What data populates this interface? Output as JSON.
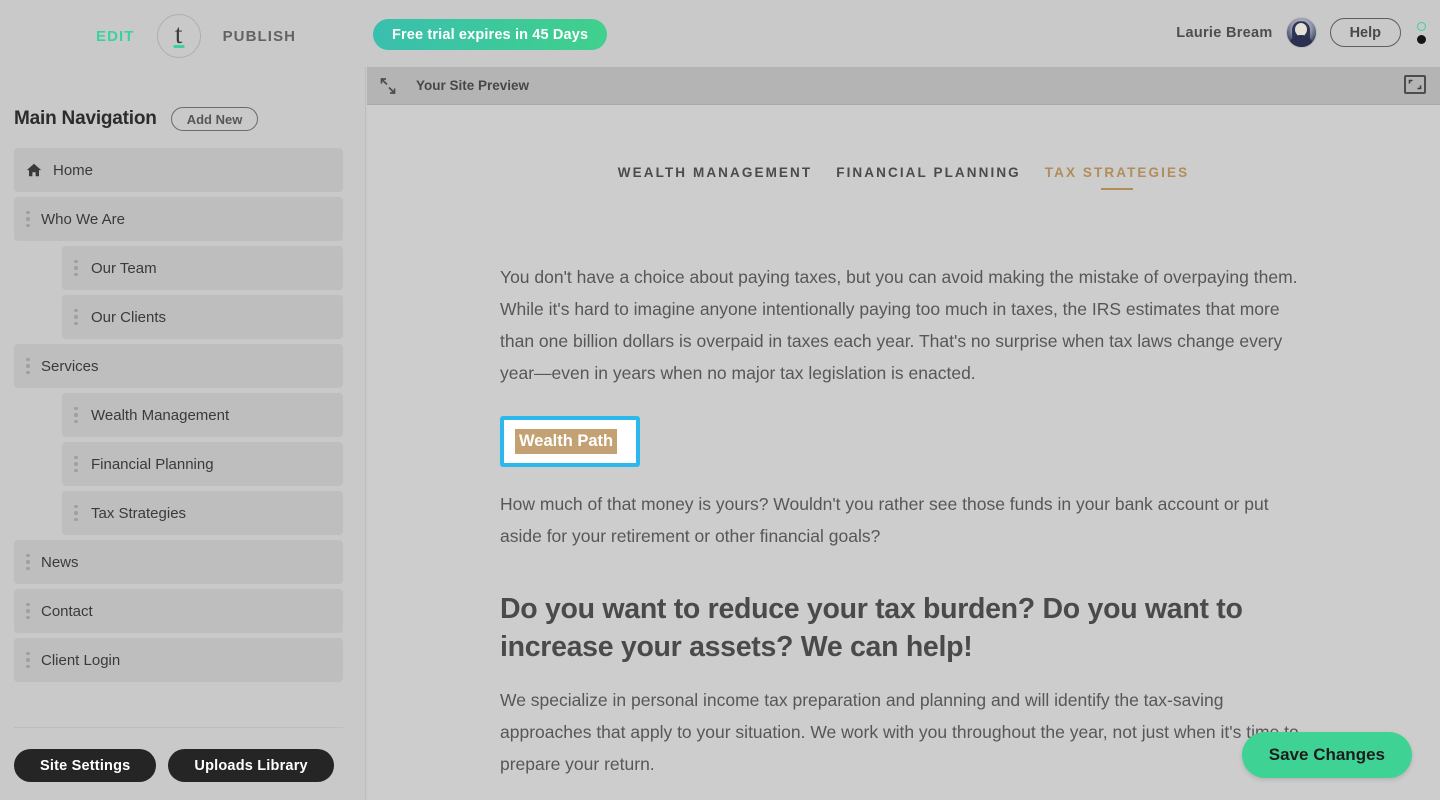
{
  "topbar": {
    "edit_label": "EDIT",
    "publish_label": "PUBLISH",
    "logo_letter": "t",
    "trial_badge": "Free trial expires in 45 Days",
    "user_name": "Laurie Bream",
    "help_label": "Help",
    "accent_green": "#3ad29f",
    "badge_gradient_from": "#39bfae",
    "badge_gradient_to": "#41d08c"
  },
  "sidebar": {
    "title": "Main Navigation",
    "add_new_label": "Add New",
    "items": [
      {
        "label": "Home",
        "icon": "home-icon",
        "level": 0
      },
      {
        "label": "Who We Are",
        "icon": "grip-icon",
        "level": 0
      },
      {
        "label": "Our Team",
        "icon": "grip-icon",
        "level": 1
      },
      {
        "label": "Our Clients",
        "icon": "grip-icon",
        "level": 1
      },
      {
        "label": "Services",
        "icon": "grip-icon",
        "level": 0
      },
      {
        "label": "Wealth Management",
        "icon": "grip-icon",
        "level": 1
      },
      {
        "label": "Financial Planning",
        "icon": "grip-icon",
        "level": 1
      },
      {
        "label": "Tax Strategies",
        "icon": "grip-icon",
        "level": 1
      },
      {
        "label": "News",
        "icon": "grip-icon",
        "level": 0
      },
      {
        "label": "Contact",
        "icon": "grip-icon",
        "level": 0
      },
      {
        "label": "Client Login",
        "icon": "grip-icon",
        "level": 0
      }
    ],
    "site_settings_label": "Site Settings",
    "uploads_library_label": "Uploads Library"
  },
  "preview": {
    "bar_title": "Your Site Preview",
    "shrink_icon": "collapse-arrows-icon",
    "expand_icon": "fullscreen-icon"
  },
  "site": {
    "nav": [
      {
        "label": "WEALTH MANAGEMENT",
        "active": false
      },
      {
        "label": "FINANCIAL PLANNING",
        "active": false
      },
      {
        "label": "TAX STRATEGIES",
        "active": true
      }
    ],
    "active_nav_color": "#b08d5a",
    "paragraph_1": "You don't have a choice about paying taxes, but you can avoid making the mistake of overpaying them. While it's hard to imagine anyone intentionally paying too much in taxes, the IRS estimates that more than one billion dollars is overpaid in taxes each year. That's no surprise when tax laws change every year—even in years when no major tax legislation is enacted.",
    "selected_element_text": "Wealth Path",
    "selection_border_color": "#2cb8ec",
    "selected_chip_bg": "#c3a172",
    "paragraph_2": "How much of that money is yours? Wouldn't you rather see those funds in your bank account or put aside for your retirement or other financial goals?",
    "heading": "Do you want to reduce your tax burden? Do you want to increase your assets? We can help!",
    "paragraph_3": "We specialize in personal income tax preparation and planning and will identify the tax-saving approaches that apply to your situation. We work with you throughout the year, not just when it's time to prepare your return."
  },
  "actions": {
    "save_label": "Save Changes",
    "save_color": "#3ed394"
  }
}
